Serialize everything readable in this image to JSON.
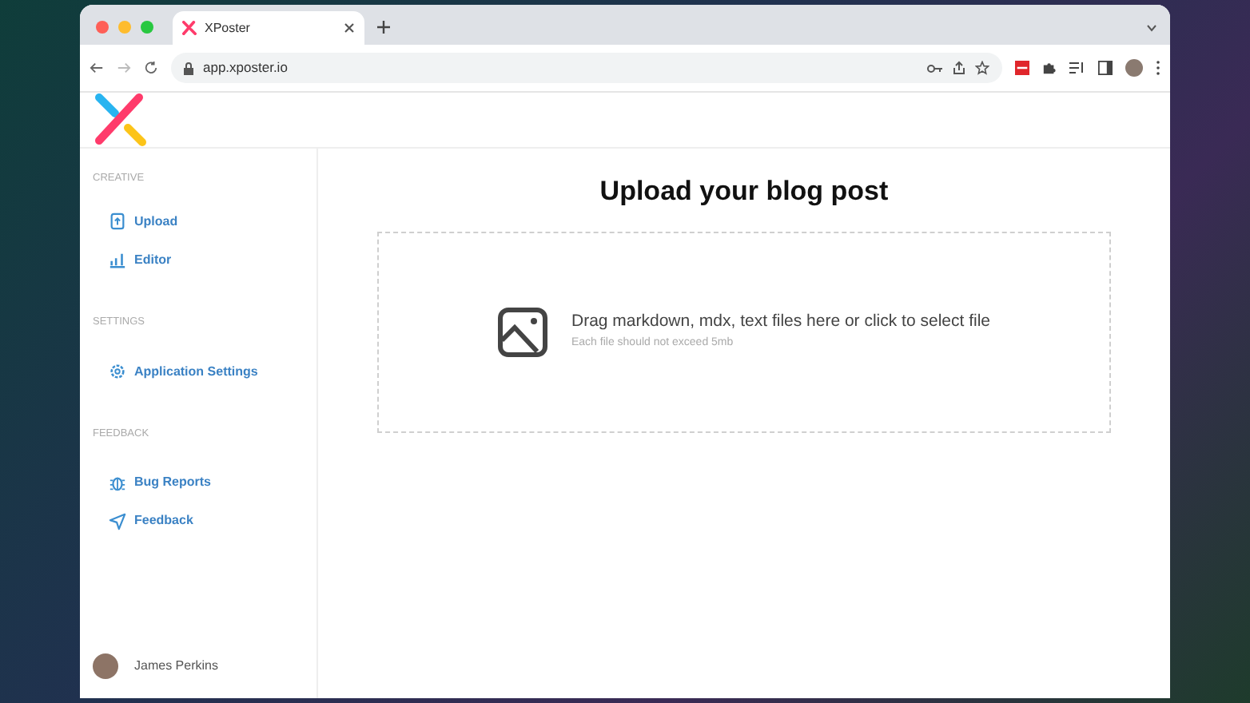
{
  "browser": {
    "tab_title": "XPoster",
    "url": "app.xposter.io"
  },
  "sidebar": {
    "sections": [
      {
        "heading": "CREATIVE",
        "items": [
          {
            "label": "Upload"
          },
          {
            "label": "Editor"
          }
        ]
      },
      {
        "heading": "SETTINGS",
        "items": [
          {
            "label": "Application Settings"
          }
        ]
      },
      {
        "heading": "FEEDBACK",
        "items": [
          {
            "label": "Bug Reports"
          },
          {
            "label": "Feedback"
          }
        ]
      }
    ],
    "user": {
      "name": "James Perkins"
    }
  },
  "main": {
    "title": "Upload your blog post",
    "dropzone": {
      "text": "Drag markdown, mdx, text files here or click to select file",
      "hint": "Each file should not exceed 5mb"
    }
  }
}
